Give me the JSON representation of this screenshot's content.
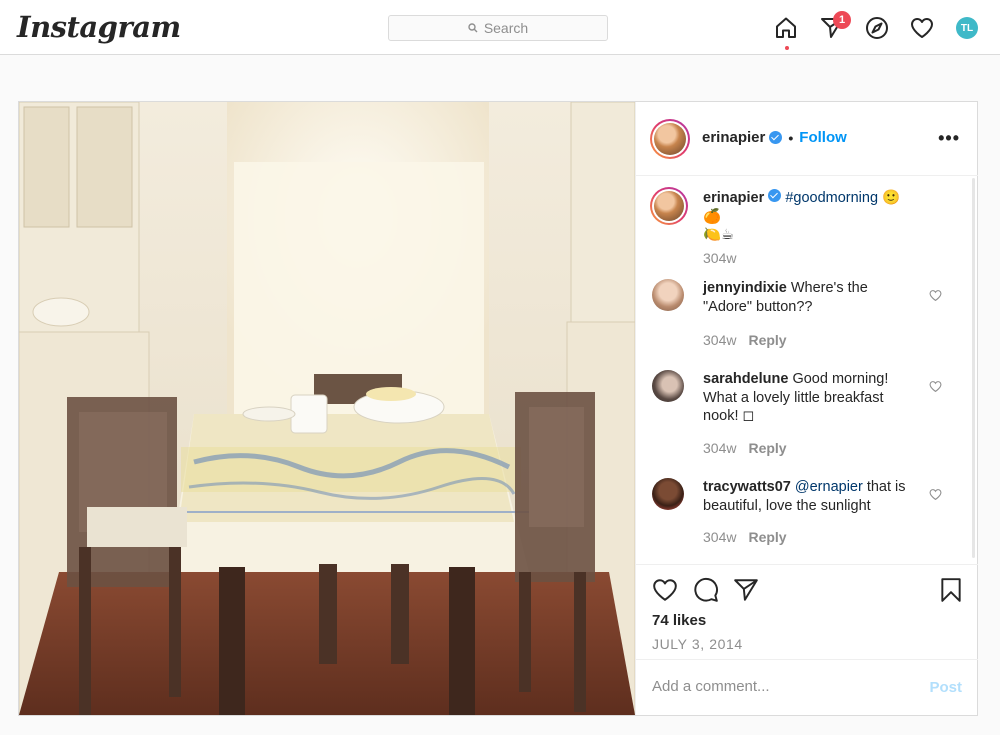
{
  "topbar": {
    "logo": "Instagram",
    "search_placeholder": "Search",
    "notification_count": "1",
    "profile_initials": "TL",
    "icons": [
      "home-icon",
      "direct-icon",
      "explore-icon",
      "activity-heart-icon",
      "profile-avatar"
    ]
  },
  "post": {
    "author": "erinapier",
    "verified": true,
    "separator": "•",
    "follow_label": "Follow",
    "more_label": "•••",
    "caption": {
      "username": "erinapier",
      "hashtag": "#goodmorning",
      "emoji_line1": "🙂🍊",
      "emoji_line2": "🍋☕",
      "time": "304w"
    },
    "comments": [
      {
        "username": "jennyindixie",
        "text": "Where's the \"Adore\" button??",
        "time": "304w",
        "reply": "Reply"
      },
      {
        "username": "sarahdelune",
        "text": "Good morning! What a lovely little breakfast nook! ◻",
        "time": "304w",
        "reply": "Reply"
      },
      {
        "username": "tracywatts07",
        "mention": "@ernapier",
        "text": "that is beautiful, love the sunlight",
        "time": "304w",
        "reply": "Reply"
      }
    ],
    "likes": "74 likes",
    "date": "JULY 3, 2014",
    "add_comment_placeholder": "Add a comment...",
    "post_label": "Post"
  },
  "colors": {
    "accent": "#0095f6",
    "badge": "#ed4956",
    "verified": "#3897f0",
    "muted": "#8e8e8e"
  }
}
